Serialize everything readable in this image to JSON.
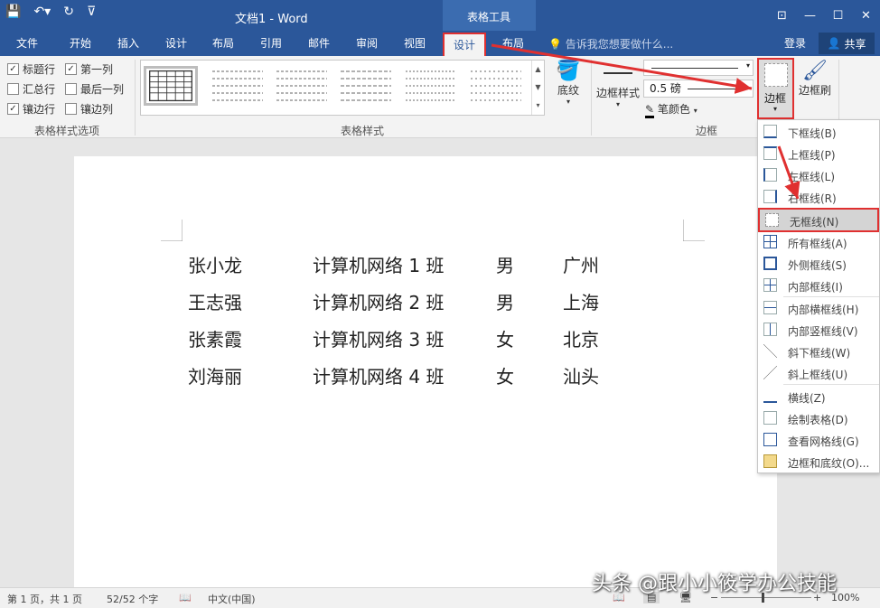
{
  "titlebar": {
    "doc_title": "文档1 - Word",
    "context_tab_title": "表格工具",
    "qat": [
      "save-icon",
      "undo-icon",
      "redo-icon",
      "customize-icon"
    ],
    "win_controls": [
      "ribbon-display-icon",
      "minimize-icon",
      "restore-icon",
      "close-icon"
    ]
  },
  "tabs": [
    "文件",
    "开始",
    "插入",
    "设计",
    "布局",
    "引用",
    "邮件",
    "审阅",
    "视图",
    "设计",
    "布局"
  ],
  "active_tab": "设计",
  "tellme": "告诉我您想要做什么...",
  "login": "登录",
  "share": "共享",
  "style_options": {
    "items": [
      {
        "label": "标题行",
        "checked": "✓"
      },
      {
        "label": "第一列",
        "checked": "✓"
      },
      {
        "label": "汇总行",
        "checked": ""
      },
      {
        "label": "最后一列",
        "checked": ""
      },
      {
        "label": "镶边行",
        "checked": "✓"
      },
      {
        "label": "镶边列",
        "checked": ""
      }
    ],
    "group_label": "表格样式选项"
  },
  "table_styles": {
    "group_label": "表格样式"
  },
  "shading": "底纹",
  "border_styles": "边框样式",
  "pen_weight": "0.5 磅",
  "pen_color": "笔颜色",
  "borders_group": "边框",
  "borders_button": "边框",
  "border_painter": "边框刷",
  "document": {
    "rows": [
      [
        "张小龙",
        "计算机网络 1 班",
        "男",
        "广州"
      ],
      [
        "王志强",
        "计算机网络 2 班",
        "男",
        "上海"
      ],
      [
        "张素霞",
        "计算机网络 3 班",
        "女",
        "北京"
      ],
      [
        "刘海丽",
        "计算机网络 4 班",
        "女",
        "汕头"
      ]
    ]
  },
  "borders_menu": [
    "下框线(B)",
    "上框线(P)",
    "左框线(L)",
    "右框线(R)",
    "无框线(N)",
    "所有框线(A)",
    "外侧框线(S)",
    "内部框线(I)",
    "内部横框线(H)",
    "内部竖框线(V)",
    "斜下框线(W)",
    "斜上框线(U)",
    "横线(Z)",
    "绘制表格(D)",
    "查看网格线(G)",
    "边框和底纹(O)..."
  ],
  "highlighted_menu_item": "无框线(N)",
  "status": {
    "page": "第 1 页，共 1 页",
    "words": "52/52 个字",
    "language": "中文(中国)",
    "zoom": "100%",
    "zoom_minus": "−",
    "zoom_plus": "+"
  },
  "watermark": "头条 @跟小小筱学办公技能",
  "colors": {
    "brand": "#2b579a",
    "highlight": "#e03030"
  }
}
